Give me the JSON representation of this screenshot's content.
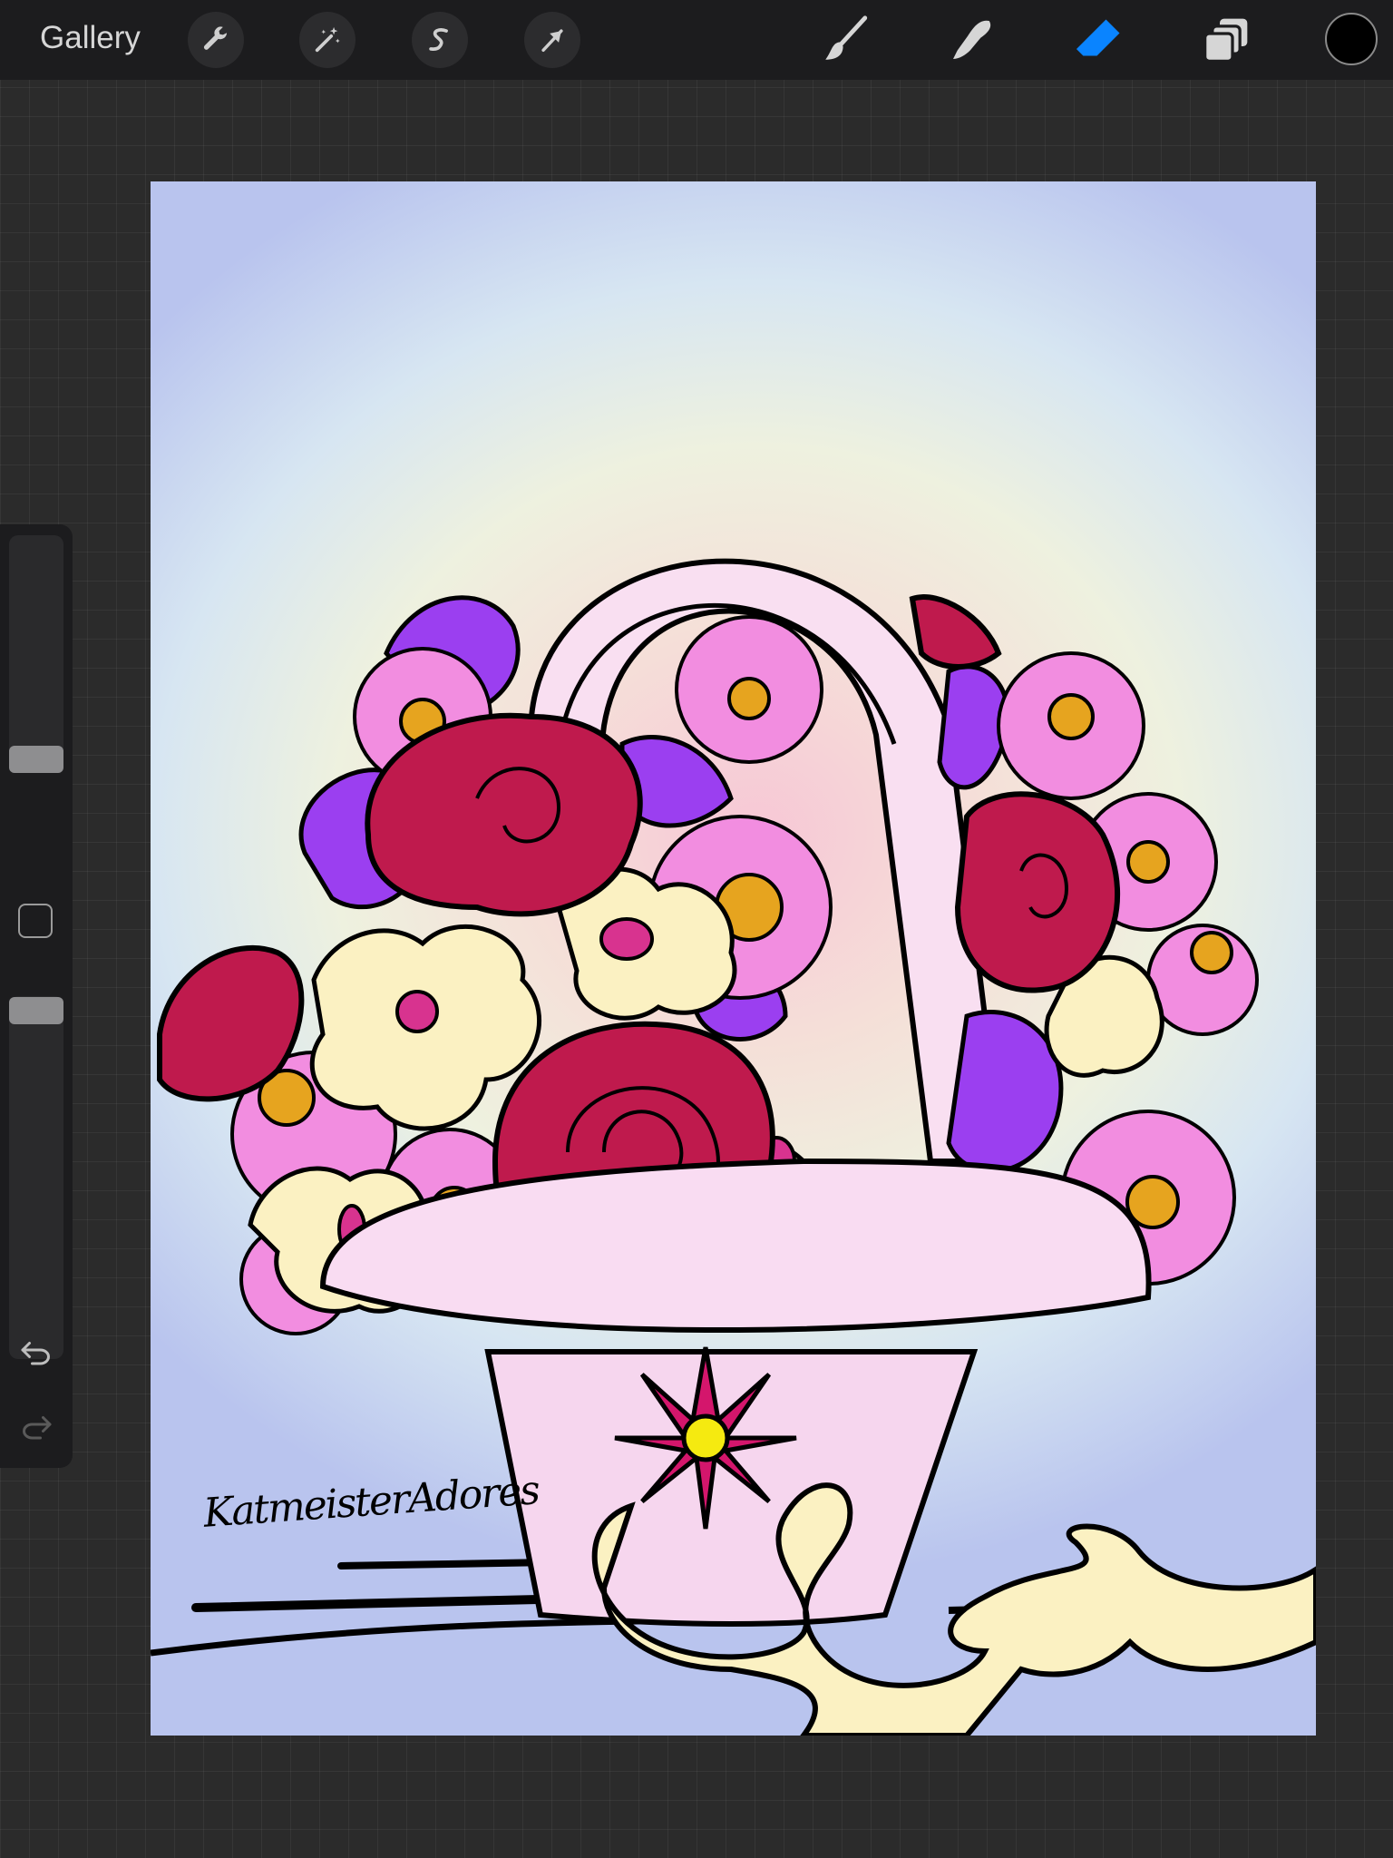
{
  "toolbar": {
    "gallery_label": "Gallery",
    "left_tools": [
      {
        "name": "actions",
        "icon": "wrench-icon"
      },
      {
        "name": "adjustments",
        "icon": "magic-wand-icon"
      },
      {
        "name": "selection",
        "icon": "selection-s-icon"
      },
      {
        "name": "transform",
        "icon": "arrow-cursor-icon"
      }
    ],
    "right_tools": [
      {
        "name": "brush",
        "icon": "brush-icon",
        "active": false
      },
      {
        "name": "smudge",
        "icon": "smudge-finger-icon",
        "active": false
      },
      {
        "name": "eraser",
        "icon": "eraser-icon",
        "active": true
      },
      {
        "name": "layers",
        "icon": "layers-icon",
        "active": false
      }
    ],
    "current_color": "#000000",
    "active_color": "#0a84ff"
  },
  "sidebar": {
    "brush_size_icon": "size-slider",
    "brush_opacity_icon": "opacity-slider",
    "modify_icon": "square-modify-icon",
    "undo_icon": "undo-arrow-icon",
    "redo_icon": "redo-arrow-icon",
    "redo_enabled": false
  },
  "canvas": {
    "signature": "KatmeisterAdores"
  }
}
